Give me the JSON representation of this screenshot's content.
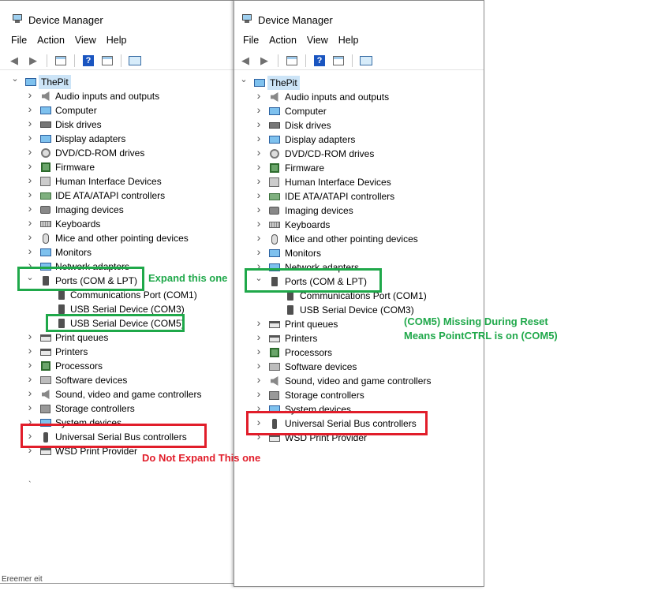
{
  "left": {
    "title": "Device Manager",
    "menu": [
      "File",
      "Action",
      "View",
      "Help"
    ],
    "root": "ThePit",
    "items": [
      {
        "label": "Audio inputs and outputs",
        "icon": "speaker-icon",
        "state": "collapsed"
      },
      {
        "label": "Computer",
        "icon": "monitor-icon",
        "state": "collapsed"
      },
      {
        "label": "Disk drives",
        "icon": "disk-icon",
        "state": "collapsed"
      },
      {
        "label": "Display adapters",
        "icon": "monitor-icon",
        "state": "collapsed"
      },
      {
        "label": "DVD/CD-ROM drives",
        "icon": "disc-icon",
        "state": "collapsed"
      },
      {
        "label": "Firmware",
        "icon": "chip-icon",
        "state": "collapsed"
      },
      {
        "label": "Human Interface Devices",
        "icon": "hid-icon",
        "state": "collapsed"
      },
      {
        "label": "IDE ATA/ATAPI controllers",
        "icon": "ide-icon",
        "state": "collapsed"
      },
      {
        "label": "Imaging devices",
        "icon": "camera-icon",
        "state": "collapsed"
      },
      {
        "label": "Keyboards",
        "icon": "keyboard-icon",
        "state": "collapsed"
      },
      {
        "label": "Mice and other pointing devices",
        "icon": "mouse-icon",
        "state": "collapsed"
      },
      {
        "label": "Monitors",
        "icon": "monitor-icon",
        "state": "collapsed"
      },
      {
        "label": "Network adapters",
        "icon": "monitor-icon",
        "state": "collapsed"
      },
      {
        "label": "Ports (COM & LPT)",
        "icon": "port-icon",
        "state": "expanded"
      },
      {
        "label": "Communications Port (COM1)",
        "icon": "port-icon",
        "state": "child"
      },
      {
        "label": "USB Serial Device (COM3)",
        "icon": "port-icon",
        "state": "child"
      },
      {
        "label": "USB Serial Device (COM5)",
        "icon": "port-icon",
        "state": "child"
      },
      {
        "label": "Print queues",
        "icon": "printer-icon",
        "state": "collapsed"
      },
      {
        "label": "Printers",
        "icon": "printer-icon",
        "state": "collapsed"
      },
      {
        "label": "Processors",
        "icon": "chip-icon",
        "state": "collapsed"
      },
      {
        "label": "Software devices",
        "icon": "box-icon",
        "state": "collapsed"
      },
      {
        "label": "Sound, video and game controllers",
        "icon": "speaker-icon",
        "state": "collapsed"
      },
      {
        "label": "Storage controllers",
        "icon": "storage-icon",
        "state": "collapsed"
      },
      {
        "label": "System devices",
        "icon": "monitor-icon",
        "state": "collapsed"
      },
      {
        "label": "Universal Serial Bus controllers",
        "icon": "usb-icon",
        "state": "collapsed"
      },
      {
        "label": "WSD Print Provider",
        "icon": "printer-icon",
        "state": "collapsed"
      }
    ],
    "note_expand": "Expand this one",
    "note_no_expand": "Do Not Expand This one",
    "bottom_fragment": "Ereemer eit"
  },
  "right": {
    "title": "Device Manager",
    "menu": [
      "File",
      "Action",
      "View",
      "Help"
    ],
    "root": "ThePit",
    "items": [
      {
        "label": "Audio inputs and outputs",
        "icon": "speaker-icon",
        "state": "collapsed"
      },
      {
        "label": "Computer",
        "icon": "monitor-icon",
        "state": "collapsed"
      },
      {
        "label": "Disk drives",
        "icon": "disk-icon",
        "state": "collapsed"
      },
      {
        "label": "Display adapters",
        "icon": "monitor-icon",
        "state": "collapsed"
      },
      {
        "label": "DVD/CD-ROM drives",
        "icon": "disc-icon",
        "state": "collapsed"
      },
      {
        "label": "Firmware",
        "icon": "chip-icon",
        "state": "collapsed"
      },
      {
        "label": "Human Interface Devices",
        "icon": "hid-icon",
        "state": "collapsed"
      },
      {
        "label": "IDE ATA/ATAPI controllers",
        "icon": "ide-icon",
        "state": "collapsed"
      },
      {
        "label": "Imaging devices",
        "icon": "camera-icon",
        "state": "collapsed"
      },
      {
        "label": "Keyboards",
        "icon": "keyboard-icon",
        "state": "collapsed"
      },
      {
        "label": "Mice and other pointing devices",
        "icon": "mouse-icon",
        "state": "collapsed"
      },
      {
        "label": "Monitors",
        "icon": "monitor-icon",
        "state": "collapsed"
      },
      {
        "label": "Network adapters",
        "icon": "monitor-icon",
        "state": "collapsed"
      },
      {
        "label": "Ports (COM & LPT)",
        "icon": "port-icon",
        "state": "expanded"
      },
      {
        "label": "Communications Port (COM1)",
        "icon": "port-icon",
        "state": "child"
      },
      {
        "label": "USB Serial Device (COM3)",
        "icon": "port-icon",
        "state": "child"
      },
      {
        "label": "Print queues",
        "icon": "printer-icon",
        "state": "collapsed"
      },
      {
        "label": "Printers",
        "icon": "printer-icon",
        "state": "collapsed"
      },
      {
        "label": "Processors",
        "icon": "chip-icon",
        "state": "collapsed"
      },
      {
        "label": "Software devices",
        "icon": "box-icon",
        "state": "collapsed"
      },
      {
        "label": "Sound, video and game controllers",
        "icon": "speaker-icon",
        "state": "collapsed"
      },
      {
        "label": "Storage controllers",
        "icon": "storage-icon",
        "state": "collapsed"
      },
      {
        "label": "System devices",
        "icon": "monitor-icon",
        "state": "collapsed"
      },
      {
        "label": "Universal Serial Bus controllers",
        "icon": "usb-icon",
        "state": "collapsed"
      },
      {
        "label": "WSD Print Provider",
        "icon": "printer-icon",
        "state": "collapsed"
      }
    ],
    "note_line1": "(COM5) Missing During  Reset",
    "note_line2": "Means PointCTRL is on (COM5)"
  },
  "colors": {
    "annotation_green": "#1fa84a",
    "annotation_red": "#e11d2a",
    "selection": "#cce4f7"
  }
}
